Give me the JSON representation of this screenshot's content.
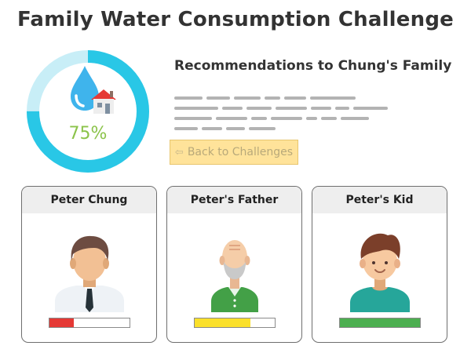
{
  "title": "Family Water Consumption Challenge",
  "progress": {
    "label": "75%",
    "value": 0.75,
    "ring_color": "#29c7e6"
  },
  "recommendations": {
    "title": "Recommendations to Chung's Family"
  },
  "back_button": {
    "label": "Back to Challenges"
  },
  "members": [
    {
      "name": "Peter Chung",
      "consumption": 0.3,
      "bar_color": "#e53935",
      "avatar": "man-avatar-icon"
    },
    {
      "name": "Peter's Father",
      "consumption": 0.7,
      "bar_color": "#fbe02a",
      "avatar": "elderly-man-avatar-icon"
    },
    {
      "name": "Peter's Kid",
      "consumption": 1.0,
      "bar_color": "#4caf50",
      "avatar": "boy-avatar-icon"
    }
  ]
}
